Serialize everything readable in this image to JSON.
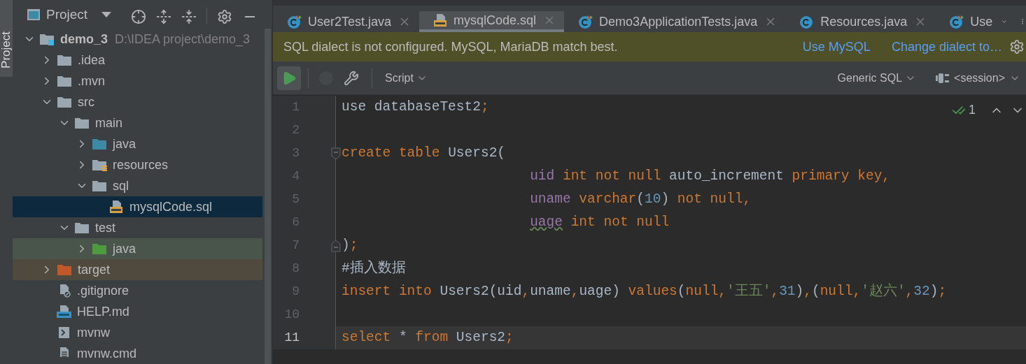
{
  "side_strip": {
    "label": "Project"
  },
  "project_panel": {
    "title": "Project",
    "tree": [
      {
        "name": "demo_3",
        "hint": "D:\\IDEA project\\demo_3",
        "kind": "module",
        "expanded": true,
        "selected": false,
        "children": [
          {
            "name": ".idea",
            "kind": "folder",
            "expanded": false,
            "selected": false
          },
          {
            "name": ".mvn",
            "kind": "folder",
            "expanded": false,
            "selected": false
          },
          {
            "name": "src",
            "kind": "folder",
            "expanded": true,
            "selected": false,
            "children": [
              {
                "name": "main",
                "kind": "folder",
                "expanded": true,
                "selected": false,
                "children": [
                  {
                    "name": "java",
                    "kind": "source",
                    "expanded": false,
                    "selected": false
                  },
                  {
                    "name": "resources",
                    "kind": "resources",
                    "expanded": false,
                    "selected": false
                  },
                  {
                    "name": "sql",
                    "kind": "folder",
                    "expanded": true,
                    "selected": false,
                    "children": [
                      {
                        "name": "mysqlCode.sql",
                        "kind": "sql",
                        "selected": true
                      }
                    ]
                  }
                ]
              },
              {
                "name": "test",
                "kind": "folder",
                "expanded": true,
                "selected": false,
                "children": [
                  {
                    "name": "java",
                    "kind": "test_source",
                    "expanded": false,
                    "selected": false
                  }
                ]
              }
            ]
          },
          {
            "name": "target",
            "kind": "excluded",
            "expanded": false,
            "selected": false
          },
          {
            "name": ".gitignore",
            "kind": "ignore",
            "selected": false
          },
          {
            "name": "HELP.md",
            "kind": "md",
            "selected": false
          },
          {
            "name": "mvnw",
            "kind": "script",
            "selected": false
          },
          {
            "name": "mvnw.cmd",
            "kind": "text",
            "selected": false
          }
        ]
      }
    ]
  },
  "tabs": [
    {
      "label": "User2Test.java",
      "kind": "java_test",
      "selected": false
    },
    {
      "label": "mysqlCode.sql",
      "kind": "sql",
      "selected": true
    },
    {
      "label": "Demo3ApplicationTests.java",
      "kind": "java_test",
      "selected": false
    },
    {
      "label": "Resources.java",
      "kind": "java",
      "selected": false
    },
    {
      "label": "Use",
      "kind": "java_test",
      "selected": false
    }
  ],
  "notification": {
    "message": "SQL dialect is not configured. MySQL, MariaDB match best.",
    "actions": [
      "Use MySQL",
      "Change dialect to…"
    ]
  },
  "toolbar": {
    "script": "Script",
    "dialect": "Generic SQL",
    "session": "<session>"
  },
  "inspection": {
    "count": "1"
  },
  "code_lines": [
    {
      "number": "1",
      "current": false,
      "fold_start": false,
      "fold_end": false,
      "tokens": [
        {
          "text": "use databaseTest2",
          "kind": "ident"
        },
        {
          "text": ";",
          "kind": "keyword"
        }
      ]
    },
    {
      "number": "2",
      "current": false,
      "fold_start": false,
      "fold_end": false
    },
    {
      "number": "3",
      "current": false,
      "fold_start": true,
      "fold_end": false,
      "tokens": [
        {
          "text": "create table",
          "kind": "keyword"
        },
        {
          "text": " Users2(",
          "kind": "ident"
        }
      ]
    },
    {
      "number": "4",
      "current": false,
      "fold_start": false,
      "fold_end": false,
      "tokens": [
        {
          "text": "                       uid",
          "kind": "column"
        },
        {
          "text": " int not null",
          "kind": "keyword"
        },
        {
          "text": " auto_increment ",
          "kind": "ident"
        },
        {
          "text": "primary key,",
          "kind": "keyword"
        }
      ]
    },
    {
      "number": "5",
      "current": false,
      "fold_start": false,
      "fold_end": false,
      "tokens": [
        {
          "text": "                       uname",
          "kind": "column"
        },
        {
          "text": " varchar",
          "kind": "keyword"
        },
        {
          "text": "(",
          "kind": "ident"
        },
        {
          "text": "10",
          "kind": "number"
        },
        {
          "text": ") ",
          "kind": "ident"
        },
        {
          "text": "not null,",
          "kind": "keyword"
        }
      ]
    },
    {
      "number": "6",
      "current": false,
      "fold_start": false,
      "fold_end": false,
      "tokens": [
        {
          "text": "                       uage",
          "kind": "unresolved"
        },
        {
          "text": " int not null",
          "kind": "keyword"
        }
      ]
    },
    {
      "number": "7",
      "current": false,
      "fold_start": false,
      "fold_end": true,
      "tokens": [
        {
          "text": ")",
          "kind": "ident"
        },
        {
          "text": ";",
          "kind": "keyword"
        }
      ]
    },
    {
      "number": "8",
      "current": false,
      "fold_start": false,
      "fold_end": false,
      "tokens": [
        {
          "text": "#插入数据",
          "kind": "comment"
        }
      ]
    },
    {
      "number": "9",
      "current": false,
      "fold_start": false,
      "fold_end": false,
      "tokens": [
        {
          "text": "insert into",
          "kind": "keyword"
        },
        {
          "text": " Users2(uid",
          "kind": "ident"
        },
        {
          "text": ",",
          "kind": "keyword"
        },
        {
          "text": "uname",
          "kind": "ident"
        },
        {
          "text": ",",
          "kind": "keyword"
        },
        {
          "text": "uage) ",
          "kind": "ident"
        },
        {
          "text": "values",
          "kind": "keyword"
        },
        {
          "text": "(",
          "kind": "ident"
        },
        {
          "text": "null,",
          "kind": "keyword"
        },
        {
          "text": "'王五'",
          "kind": "string"
        },
        {
          "text": ",",
          "kind": "keyword"
        },
        {
          "text": "31",
          "kind": "number"
        },
        {
          "text": ")",
          "kind": "ident"
        },
        {
          "text": ",",
          "kind": "keyword"
        },
        {
          "text": "(",
          "kind": "ident"
        },
        {
          "text": "null,",
          "kind": "keyword"
        },
        {
          "text": "'赵六'",
          "kind": "string"
        },
        {
          "text": ",",
          "kind": "keyword"
        },
        {
          "text": "32",
          "kind": "number"
        },
        {
          "text": ")",
          "kind": "ident"
        },
        {
          "text": ";",
          "kind": "keyword"
        }
      ]
    },
    {
      "number": "10",
      "current": false,
      "fold_start": false,
      "fold_end": false
    },
    {
      "number": "11",
      "current": true,
      "fold_start": false,
      "fold_end": false,
      "tokens": [
        {
          "text": "select",
          "kind": "keyword"
        },
        {
          "text": " * ",
          "kind": "ident"
        },
        {
          "text": "from",
          "kind": "keyword"
        },
        {
          "text": " Users2",
          "kind": "ident"
        },
        {
          "text": ";",
          "kind": "keyword"
        }
      ]
    }
  ]
}
